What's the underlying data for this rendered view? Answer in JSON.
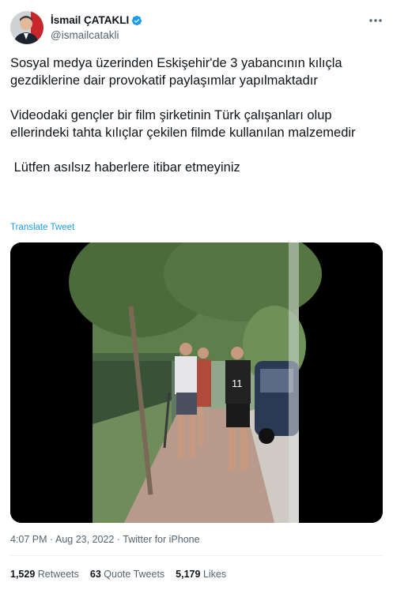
{
  "author": {
    "name": "İsmail ÇATAKLI",
    "handle": "@ismailcatakli",
    "verified": true,
    "avatar_icon": "profile-photo"
  },
  "tweet": {
    "paragraphs": [
      "Sosyal medya üzerinden Eskişehir'de 3 yabancının kılıçla gezdiklerine dair provokatif paylaşımlar yapılmaktadır",
      "Videodaki gençler bir film şirketinin Türk çalışanları olup ellerindeki tahta kılıçlar çekilen filmde kullanılan malzemedir",
      " Lütfen asılsız haberlere itibar etmeyiniz"
    ],
    "translate_label": "Translate Tweet"
  },
  "media": {
    "type": "video",
    "description_icon": "video-frame"
  },
  "meta": {
    "time": "4:07 PM",
    "separator": "·",
    "date": "Aug 23, 2022",
    "source": "Twitter for iPhone"
  },
  "stats": {
    "retweets_count": "1,529",
    "retweets_label": "Retweets",
    "quotes_count": "63",
    "quotes_label": "Quote Tweets",
    "likes_count": "5,179",
    "likes_label": "Likes"
  },
  "colors": {
    "link": "#1d9bf0",
    "text": "#0f1419",
    "secondary": "#536471",
    "verified": "#1d9bf0"
  }
}
